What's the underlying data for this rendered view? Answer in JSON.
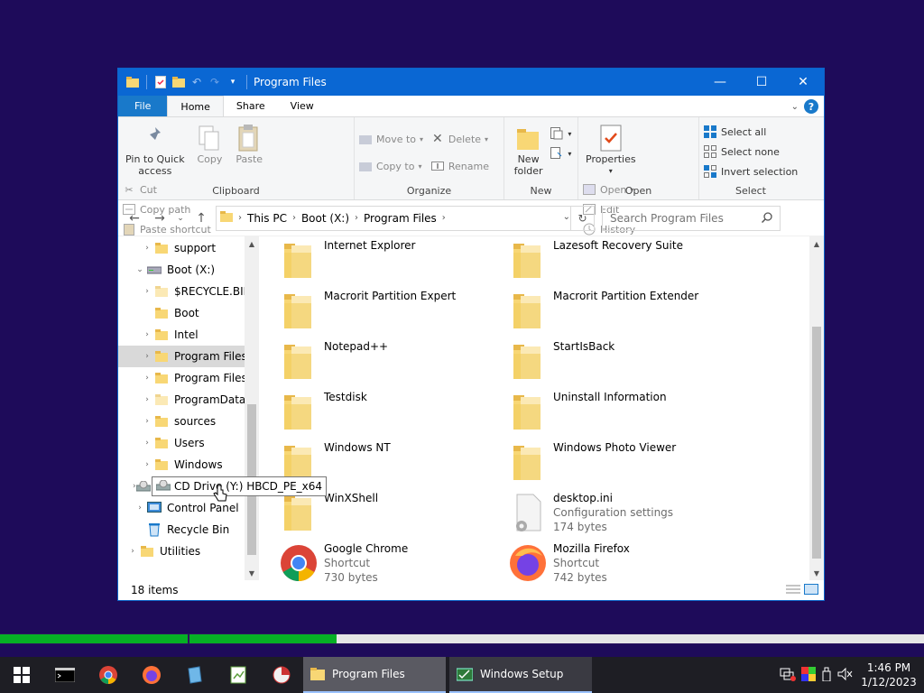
{
  "window": {
    "title": "Program Files",
    "controls": {
      "minimize": "—",
      "maximize": "☐",
      "close": "✕"
    }
  },
  "ribbon": {
    "tabs": [
      "File",
      "Home",
      "Share",
      "View"
    ],
    "clipboard": {
      "pin_line1": "Pin to Quick",
      "pin_line2": "access",
      "copy": "Copy",
      "paste": "Paste",
      "cut": "Cut",
      "copy_path": "Copy path",
      "paste_shortcut": "Paste shortcut",
      "group": "Clipboard"
    },
    "organize": {
      "move_to": "Move to",
      "copy_to": "Copy to",
      "delete": "Delete",
      "rename": "Rename",
      "group": "Organize"
    },
    "new": {
      "new_line1": "New",
      "new_line2": "folder",
      "group": "New"
    },
    "open": {
      "properties": "Properties",
      "open": "Open",
      "edit": "Edit",
      "history": "History",
      "group": "Open"
    },
    "select": {
      "select_all": "Select all",
      "select_none": "Select none",
      "invert": "Invert selection",
      "group": "Select"
    }
  },
  "address": {
    "crumbs": [
      "This PC",
      "Boot (X:)",
      "Program Files"
    ],
    "search_placeholder": "Search Program Files"
  },
  "nav": {
    "items": [
      {
        "label": "support"
      },
      {
        "label": "Boot (X:)"
      },
      {
        "label": "$RECYCLE.BIN"
      },
      {
        "label": "Boot"
      },
      {
        "label": "Intel"
      },
      {
        "label": "Program Files"
      },
      {
        "label": "Program Files"
      },
      {
        "label": "ProgramData"
      },
      {
        "label": "sources"
      },
      {
        "label": "Users"
      },
      {
        "label": "Windows"
      },
      {
        "label": "CD Drive (Y:) HBCD_PE_x64"
      },
      {
        "label": "Control Panel"
      },
      {
        "label": "Recycle Bin"
      },
      {
        "label": "Utilities"
      }
    ]
  },
  "files": [
    {
      "name": "Internet Explorer"
    },
    {
      "name": "Lazesoft Recovery Suite"
    },
    {
      "name": "Macrorit Partition Expert"
    },
    {
      "name": "Macrorit Partition Extender"
    },
    {
      "name": "Notepad++"
    },
    {
      "name": "StartIsBack"
    },
    {
      "name": "Testdisk"
    },
    {
      "name": "Uninstall Information"
    },
    {
      "name": "Windows NT"
    },
    {
      "name": "Windows Photo Viewer"
    },
    {
      "name": "WinXShell"
    },
    {
      "name": "desktop.ini",
      "type": "Configuration settings",
      "size": "174 bytes"
    },
    {
      "name": "Google Chrome",
      "type": "Shortcut",
      "size": "730 bytes"
    },
    {
      "name": "Mozilla Firefox",
      "type": "Shortcut",
      "size": "742 bytes"
    }
  ],
  "status": {
    "count": "18 items"
  },
  "tooltip": {
    "text": "CD Drive (Y:) HBCD_PE_x64"
  },
  "progress": {
    "bar1": 1.0,
    "bar2": 0.2
  },
  "taskbar": {
    "windows": [
      "Program Files",
      "Windows Setup"
    ],
    "time": "1:46 PM",
    "date": "1/12/2023"
  },
  "colors": {
    "titlebar": "#0a67d3",
    "desktop": "#1e0b5a",
    "progress": "#06b025"
  }
}
